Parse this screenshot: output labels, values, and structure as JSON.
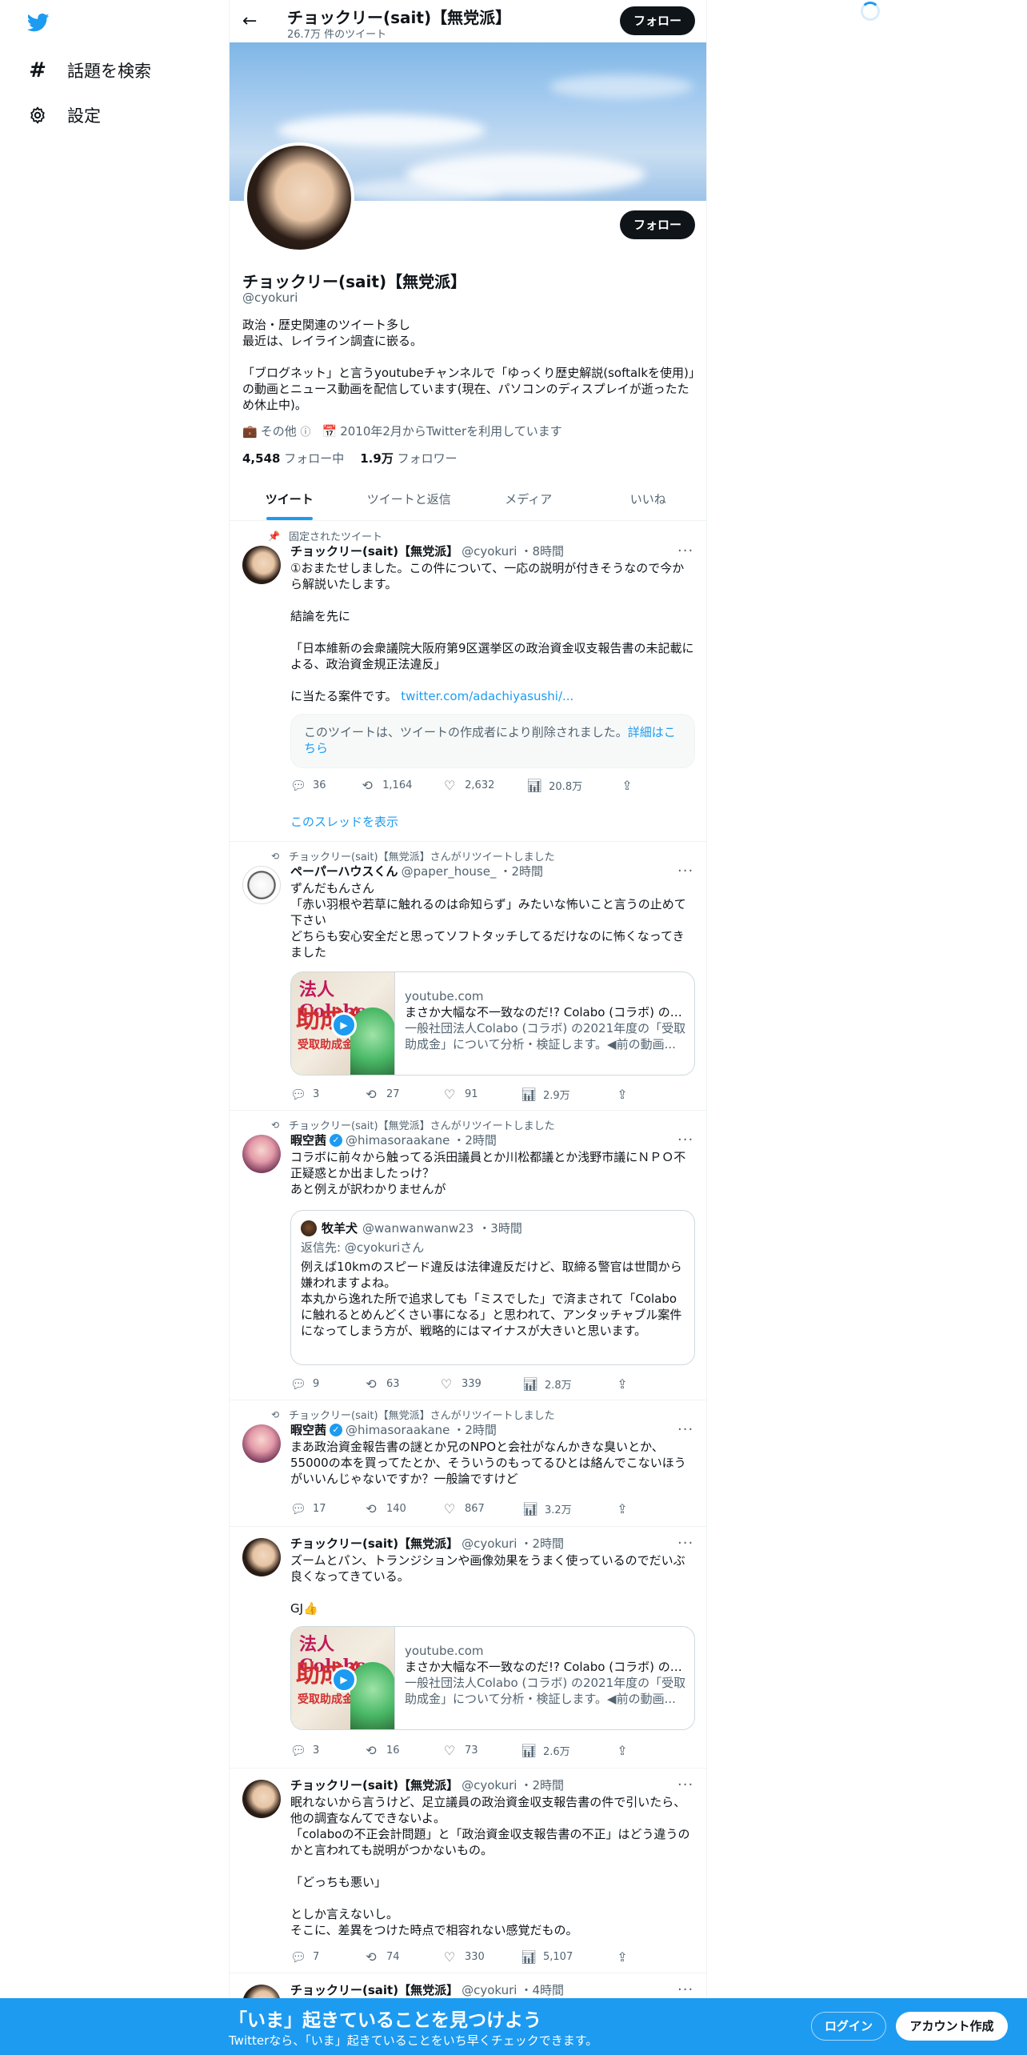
{
  "nav": {
    "explore_label": "話題を検索",
    "settings_label": "設定"
  },
  "header": {
    "name": "チョックリー(sait)【無党派】",
    "tweet_count": "26.7万 件のツイート",
    "follow_label": "フォロー"
  },
  "profile": {
    "name": "チョックリー(sait)【無党派】",
    "handle": "@cyokuri",
    "follow_label": "フォロー",
    "bio": "政治・歴史関連のツイート多し\n最近は、レイライン調査に嵌る。\n\n「ブログネット」と言うyoutubeチャンネルで「ゆっくり歴史解説(softalkを使用)」の動画とニュース動画を配信しています(現在、パソコンのディスプレイが逝ったため休止中)。",
    "category": "その他",
    "joined": "2010年2月からTwitterを利用しています",
    "following_count": "4,548",
    "following_label": "フォロー中",
    "followers_count": "1.9万",
    "followers_label": "フォロワー"
  },
  "tabs": [
    "ツイート",
    "ツイートと返信",
    "メディア",
    "いいね"
  ],
  "tweets": [
    {
      "context": "固定されたツイート",
      "name": "チョックリー(sait)【無党派】",
      "handle": "@cyokuri",
      "time": "・8時間",
      "body": "①おまたせしました。この件について、一応の説明が付きそうなので今から解説いたします。\n\n結論を先に\n\n「日本維新の会衆議院大阪府第9区選挙区の政治資金収支報告書の未記載による、政治資金規正法違反」\n\n",
      "body_end": "に当たる案件です。",
      "link": "twitter.com/adachiyasushi/...",
      "deleted_text": "このツイートは、ツイートの作成者により削除されました。",
      "deleted_link": "詳細はこちら",
      "replies": "36",
      "retweets": "1,164",
      "likes": "2,632",
      "views": "20.8万",
      "thread_link": "このスレッドを表示"
    },
    {
      "context": "チョックリー(sait)【無党派】さんがリツイートしました",
      "name": "ペーパーハウスくん",
      "handle": "@paper_house_",
      "time": "・2時間",
      "body": "ずんだもんさん\n「赤い羽根や若草に触れるのは命知らず」みたいな怖いこと言うの止めて下さい\nどちらも安心安全だと思ってソフトタッチしてるだけなのに怖くなってきました",
      "card": {
        "thumb_title": "法人Colabo",
        "thumb_main": "助成金",
        "thumb_sub": "受取助成金",
        "domain": "youtube.com",
        "title": "まさか大幅な不一致なのだ!? Colabo (コラボ) の2021年度の受取助成金を検証",
        "desc": "一般社団法人Colabo (コラボ) の2021年度の「受取助成金」について分析・検証します。◀前の動画..."
      },
      "replies": "3",
      "retweets": "27",
      "likes": "91",
      "views": "2.9万"
    },
    {
      "context": "チョックリー(sait)【無党派】さんがリツイートしました",
      "name": "暇空茜",
      "handle": "@himasoraakane",
      "time": "・2時間",
      "body": "コラボに前々から触ってる浜田議員とか川松都議とか浅野市議にＮＰＯ不正疑惑とか出ましたっけ？\nあと例えが訳わかりませんが",
      "quote": {
        "name": "牧羊犬",
        "handle": "@wanwanwanw23",
        "time": "・3時間",
        "reply_to": "返信先: @cyokuriさん",
        "body": "例えば10kmのスピード違反は法律違反だけど、取締る警官は世間から嫌われますよね。\n本丸から逸れた所で追求しても「ミスでした」で済まされて「Colaboに触れるとめんどくさい事になる」と思われて、アンタッチャブル案件になってしまう方が、戦略的にはマイナスが大きいと思います。"
      },
      "replies": "9",
      "retweets": "63",
      "likes": "339",
      "views": "2.8万"
    },
    {
      "context": "チョックリー(sait)【無党派】さんがリツイートしました",
      "name": "暇空茜",
      "handle": "@himasoraakane",
      "time": "・2時間",
      "body": "まあ政治資金報告書の謎とか兄のNPOと会社がなんかきな臭いとか、55000の本を買ってたとか、そういうのもってるひとは絡んでこないほうがいいんじゃないですか？一般論ですけど",
      "replies": "17",
      "retweets": "140",
      "likes": "867",
      "views": "3.2万"
    },
    {
      "name": "チョックリー(sait)【無党派】",
      "handle": "@cyokuri",
      "time": "・2時間",
      "body": "ズームとパン、トランジションや画像効果をうまく使っているのでだいぶ良くなってきている。\n\nGJ👍",
      "card": {
        "thumb_title": "法人Colabo",
        "thumb_main": "助成金",
        "thumb_sub": "受取助成金",
        "domain": "youtube.com",
        "title": "まさか大幅な不一致なのだ!? Colabo (コラボ) の2021年度の受取助成金を検証",
        "desc": "一般社団法人Colabo (コラボ) の2021年度の「受取助成金」について分析・検証します。◀前の動画..."
      },
      "replies": "3",
      "retweets": "16",
      "likes": "73",
      "views": "2.6万"
    },
    {
      "name": "チョックリー(sait)【無党派】",
      "handle": "@cyokuri",
      "time": "・2時間",
      "body": "眠れないから言うけど、足立議員の政治資金収支報告書の件で引いたら、他の調査なんてできないよ。\n「colaboの不正会計問題」と「政治資金収支報告書の不正」はどう違うのかと言われても説明がつかないもの。\n\n「どっちも悪い」\n\nとしか言えないし。\nそこに、差異をつけた時点で相容れない感覚だもの。",
      "replies": "7",
      "retweets": "74",
      "likes": "330",
      "views": "5,107"
    },
    {
      "name": "チョックリー(sait)【無党派】",
      "handle": "@cyokuri",
      "time": "・4時間"
    }
  ],
  "bottom_bar": {
    "title": "「いま」起きていることを見つけよう",
    "subtitle": "Twitterなら、「いま」起きていることをいち早くチェックできます。",
    "login_label": "ログイン",
    "signup_label": "アカウント作成"
  },
  "colors": {
    "accent": "#1d9bf0",
    "text": "#0f1419",
    "secondary": "#536471"
  }
}
